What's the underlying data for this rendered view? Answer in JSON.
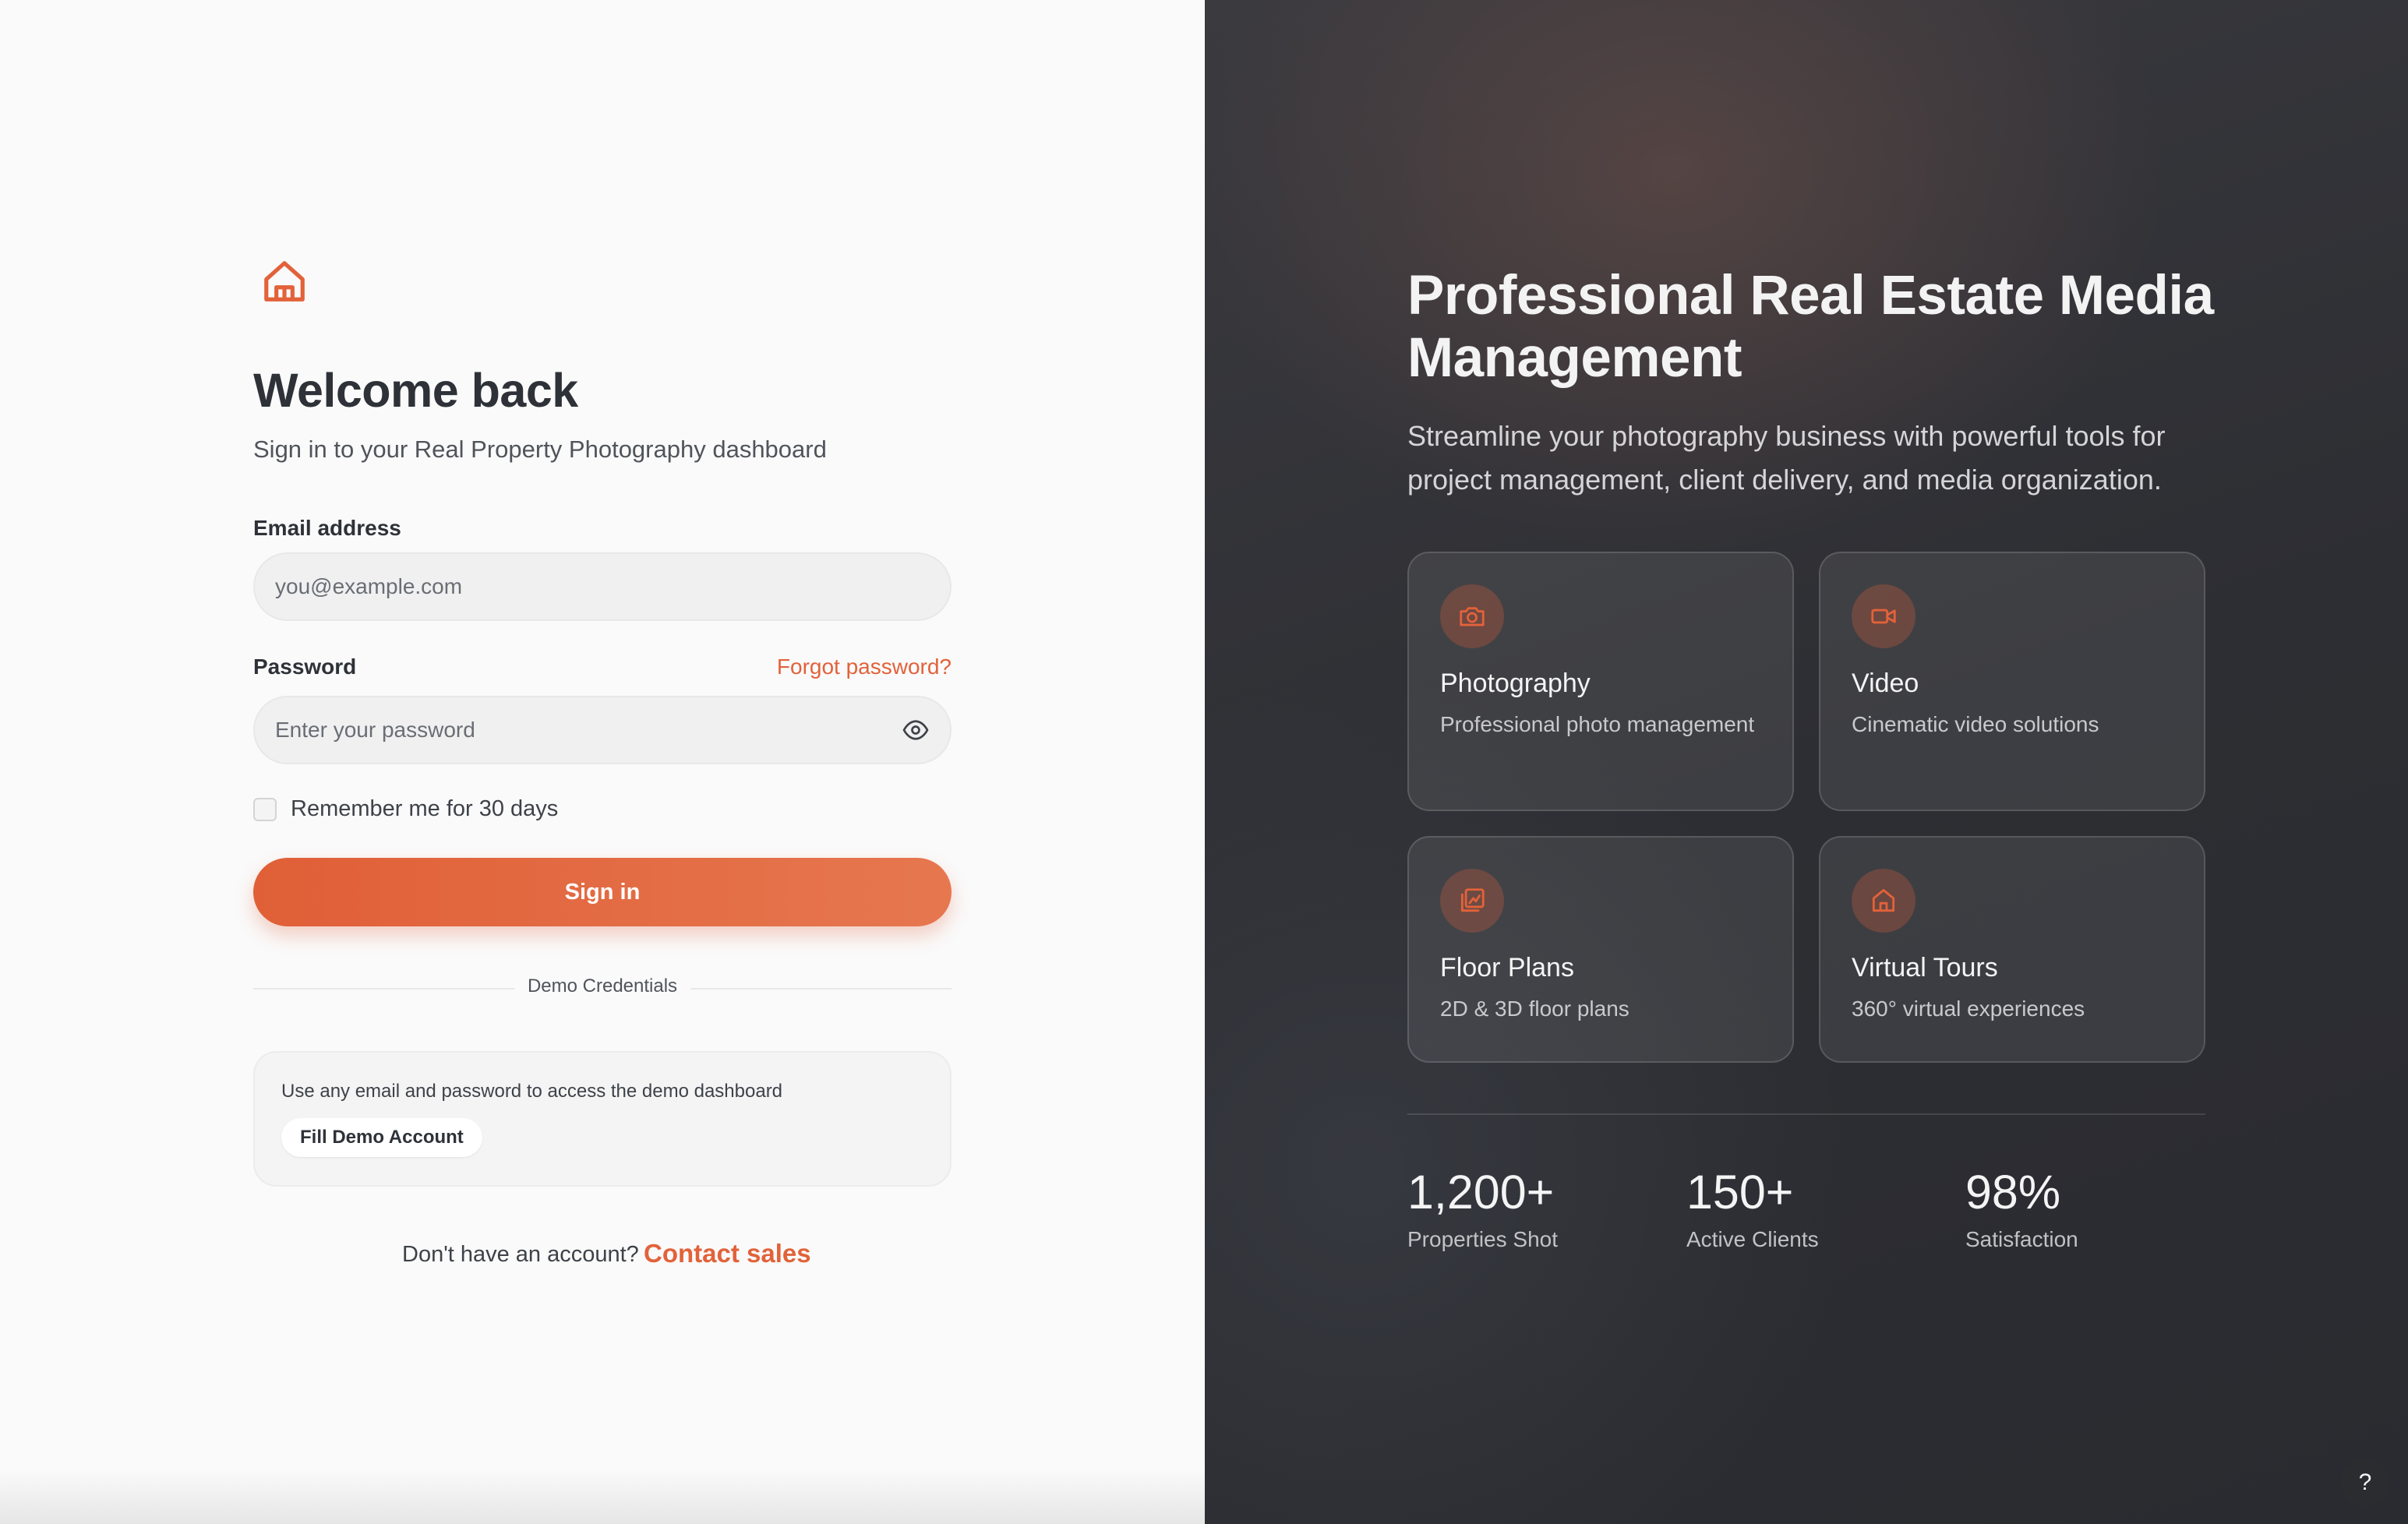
{
  "brand": {
    "logo_icon": "home-icon",
    "accent_color": "#e2623a"
  },
  "login": {
    "title": "Welcome back",
    "subtitle": "Sign in to your Real Property Photography dashboard",
    "email_label": "Email address",
    "email_placeholder": "you@example.com",
    "email_value": "",
    "password_label": "Password",
    "forgot_link": "Forgot password?",
    "password_placeholder": "Enter your password",
    "password_value": "",
    "remember_label": "Remember me for 30 days",
    "remember_checked": false,
    "signin_button": "Sign in",
    "demo_divider": "Demo Credentials",
    "demo_text": "Use any email and password to access the demo dashboard",
    "demo_button": "Fill Demo Account",
    "no_account_text": "Don't have an account?",
    "contact_link": "Contact sales"
  },
  "hero": {
    "title": "Professional Real Estate Media Management",
    "subtitle": "Streamline your photography business with powerful tools for project management, client delivery, and media organization.",
    "features": [
      {
        "icon": "camera-icon",
        "title": "Photography",
        "desc": "Professional photo management"
      },
      {
        "icon": "video-icon",
        "title": "Video",
        "desc": "Cinematic video solutions"
      },
      {
        "icon": "floor-plan-icon",
        "title": "Floor Plans",
        "desc": "2D & 3D floor plans"
      },
      {
        "icon": "home-icon",
        "title": "Virtual Tours",
        "desc": "360° virtual experiences"
      }
    ],
    "stats": [
      {
        "value": "1,200+",
        "label": "Properties Shot"
      },
      {
        "value": "150+",
        "label": "Active Clients"
      },
      {
        "value": "98%",
        "label": "Satisfaction"
      }
    ]
  },
  "help": {
    "label": "?"
  }
}
